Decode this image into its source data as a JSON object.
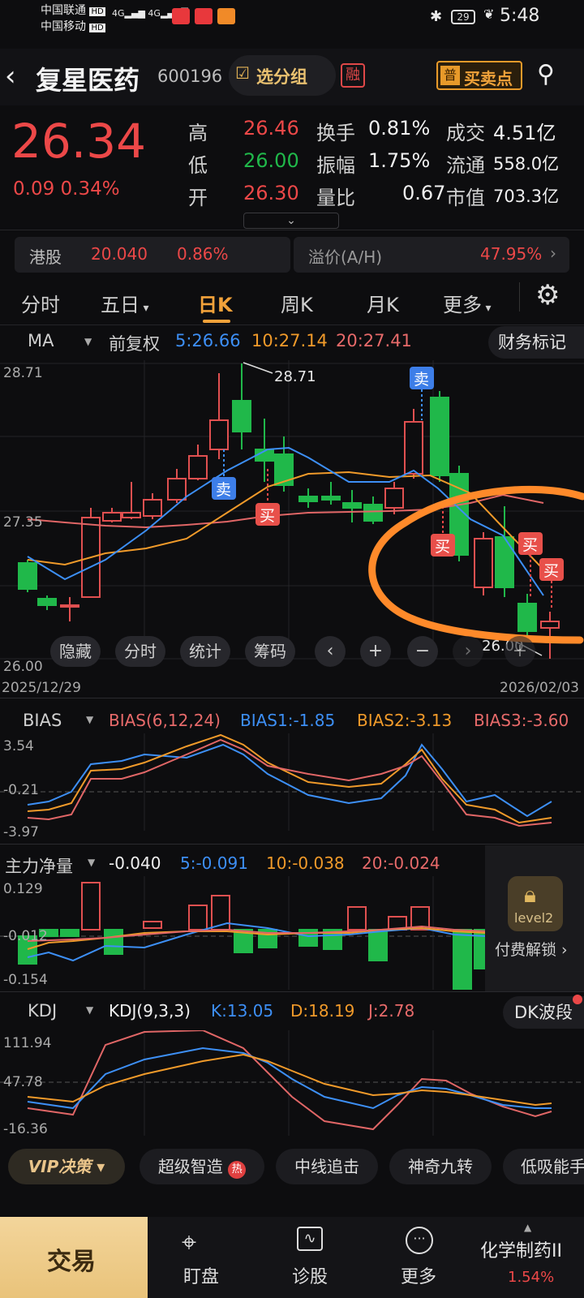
{
  "status": {
    "carrier1": "中国联通",
    "carrier2": "中国移动",
    "hd": "HD",
    "net": "4G",
    "battery": "29",
    "time": "5:48"
  },
  "header": {
    "title": "复星医药",
    "code": "600196",
    "group_label": "选分组",
    "rong": "融",
    "buysell_icon": "普",
    "buysell_label": "买卖点"
  },
  "quote": {
    "price": "26.34",
    "change": "0.09",
    "change_pct": "0.34%",
    "high_label": "高",
    "high": "26.46",
    "low_label": "低",
    "low": "26.00",
    "open_label": "开",
    "open": "26.30",
    "turnover_label": "换手",
    "turnover": "0.81%",
    "amplitude_label": "振幅",
    "amplitude": "1.75%",
    "volratio_label": "量比",
    "volratio": "0.67",
    "amount_label": "成交",
    "amount": "4.51亿",
    "float_label": "流通",
    "float": "558.0亿",
    "mcap_label": "市值",
    "mcap": "703.3亿"
  },
  "hk": {
    "label": "港股",
    "price": "20.040",
    "pct": "0.86%",
    "premium_label": "溢价(A/H)",
    "premium": "47.95%"
  },
  "tabs": [
    "分时",
    "五日",
    "日K",
    "周K",
    "月K",
    "更多"
  ],
  "ma": {
    "label": "MA",
    "adjust": "前复权",
    "ma5": "5:26.66",
    "ma10": "10:27.14",
    "ma20": "20:27.41",
    "finance_btn": "财务标记"
  },
  "kline": {
    "hi": "28.71",
    "mid": "27.35",
    "lo": "26.00",
    "peak_label": "28.71",
    "low_label": "26.00",
    "date_start": "2025/12/29",
    "date_end": "2026/02/03",
    "sell": "卖",
    "buy": "买"
  },
  "chart_buttons": [
    "隐藏",
    "分时",
    "统计",
    "筹码"
  ],
  "bias": {
    "label": "BIAS",
    "params": "BIAS(6,12,24)",
    "b1": "BIAS1:-1.85",
    "b2": "BIAS2:-3.13",
    "b3": "BIAS3:-3.60",
    "top": "3.54",
    "mid": "-0.21",
    "bot": "-3.97"
  },
  "flow": {
    "label": "主力净量",
    "value": "-0.040",
    "f5": "5:-0.091",
    "f10": "10:-0.038",
    "f20": "20:-0.024",
    "top": "0.129",
    "mid": "-0.012",
    "bot": "-0.154",
    "lock_label": "level2",
    "unlock": "付费解锁"
  },
  "kdj": {
    "label": "KDJ",
    "params": "KDJ(9,3,3)",
    "k": "K:13.05",
    "d": "D:18.19",
    "j": "J:2.78",
    "wave_btn": "DK波段",
    "top": "111.94",
    "mid": "47.78",
    "bot": "-16.36"
  },
  "features": {
    "vip": "VIP决策",
    "items": [
      "超级智造",
      "中线追击",
      "神奇九转",
      "低吸能手"
    ],
    "hot": "热"
  },
  "nav": {
    "trade": "交易",
    "watch": "盯盘",
    "diagnose": "诊股",
    "more": "更多",
    "sector": "化学制药II",
    "sector_pct": "1.54%"
  }
}
